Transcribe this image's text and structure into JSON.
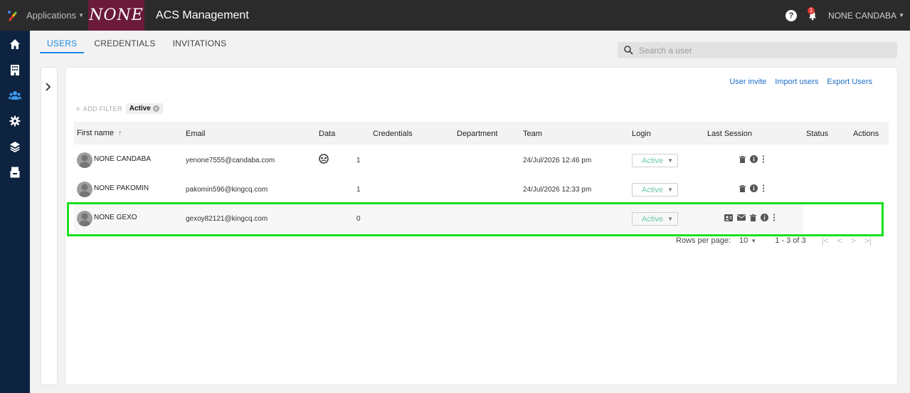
{
  "header": {
    "apps_label": "Applications",
    "brand_logo_text": "NONE",
    "app_title": "ACS Management",
    "notification_count": "1",
    "user_name": "NONE CANDABA"
  },
  "nav": {
    "icons": [
      "home-icon",
      "building-icon",
      "users-icon",
      "settings-icon",
      "layers-icon",
      "archive-icon"
    ],
    "active": "users-icon"
  },
  "tabs": [
    "USERS",
    "CREDENTIALS",
    "INVITATIONS"
  ],
  "search": {
    "placeholder": "Search a user"
  },
  "card_actions": [
    "User invite",
    "Import users",
    "Export Users"
  ],
  "filters": {
    "add_filter_label": "ADD FILTER",
    "chip_label": "Active"
  },
  "table": {
    "columns": [
      "First name",
      "Email",
      "Data",
      "Credentials",
      "Department",
      "Team",
      "Login",
      "Last Session",
      "Status",
      "Actions"
    ],
    "rows": [
      {
        "name": "NONE CANDABA",
        "email": "yenone7555@candaba.com",
        "data_icon": "dataset-icon",
        "credentials": "1",
        "team": "",
        "last_login": "24/Jul/2026 12:46 pm",
        "login": "Active"
      },
      {
        "name": "NONE PAKOMIN",
        "email": "pakomin596@kingcq.com",
        "credentials": "1",
        "last_login": "24/Jul/2026 12:33 pm",
        "login": "Active"
      },
      {
        "name": "NONE GEXO",
        "email": "gexoy82121@kingcq.com",
        "credentials": "0",
        "last_login": "",
        "login": "Active"
      }
    ]
  },
  "pagination": {
    "rows_per_page_label": "Rows per page:",
    "rows_per_page": "10",
    "range": "1 - 3 of 3"
  },
  "colors": {
    "topbar": "#2b2b2b",
    "brand": "#6b1a3a",
    "leftnav": "#0d2340",
    "accent": "#1e88e5",
    "active_status": "#6dc7a8",
    "highlight": "#19e01f"
  }
}
